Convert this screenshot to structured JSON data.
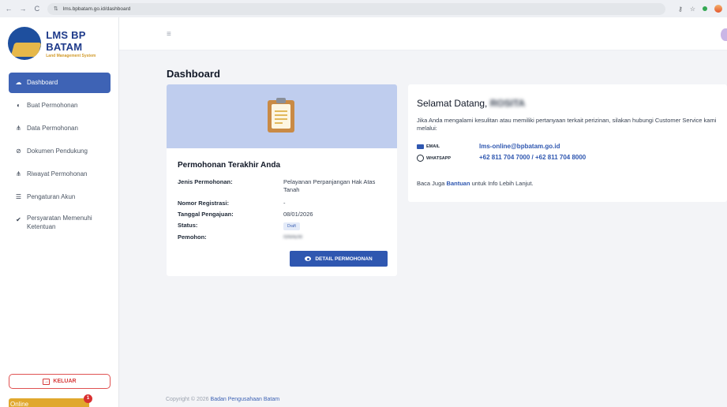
{
  "browser": {
    "url": "lms.bpbatam.go.id/dashboard",
    "back_icon": "←",
    "forward_icon": "→",
    "reload_icon": "C",
    "site_settings_icon": "⇅",
    "key_icon": "⚷",
    "star_icon": "☆"
  },
  "brand": {
    "title": "LMS BP BATAM",
    "subtitle": "Land Management System"
  },
  "sidebar": {
    "items": [
      {
        "label": "Dashboard",
        "icon": "cloud-icon",
        "glyph": "☁",
        "active": true
      },
      {
        "label": "Buat Permohonan",
        "icon": "globe-icon",
        "glyph": "◐",
        "active": false
      },
      {
        "label": "Data Permohonan",
        "icon": "sitemap-icon",
        "glyph": "⋔",
        "active": false
      },
      {
        "label": "Dokumen Pendukung",
        "icon": "paperclip-icon",
        "glyph": "⊘",
        "active": false
      },
      {
        "label": "Riwayat Permohonan",
        "icon": "sitemap-icon",
        "glyph": "⋔",
        "active": false
      },
      {
        "label": "Pengaturan Akun",
        "icon": "settings-icon",
        "glyph": "☰",
        "active": false
      },
      {
        "label": "Persyaratan Memenuhi Ketentuan",
        "icon": "check-circle-icon",
        "glyph": "✔",
        "active": false
      }
    ],
    "logout_label": "KELUAR",
    "logout_icon": "→",
    "online_label": "Online",
    "online_badge": "1"
  },
  "header": {
    "menu_icon": "≡"
  },
  "page": {
    "title": "Dashboard"
  },
  "application": {
    "heading": "Permohonan Terakhir Anda",
    "fields": {
      "jenis_label": "Jenis Permohonan:",
      "jenis_value": "Pelayanan Perpanjangan Hak Atas Tanah",
      "nomor_label": "Nomor Registrasi:",
      "nomor_value": "-",
      "tanggal_label": "Tanggal Pengajuan:",
      "tanggal_value": "08/01/2026",
      "status_label": "Status:",
      "status_value": "Draft",
      "pemohon_label": "Pemohon:",
      "pemohon_value": "ISNAENI"
    },
    "detail_button": "DETAIL PERMOHONAN"
  },
  "welcome": {
    "greeting": "Selamat Datang,",
    "name": "ROSITA",
    "description": "Jika Anda mengalami kesulitan atau memiliki pertanyaan terkait perizinan, silakan hubungi Customer Service kami melalui:",
    "email_label": "EMAIL",
    "email_value": "lms-online@bpbatam.go.id",
    "whatsapp_label": "WHATSAPP",
    "whatsapp_value": "+62 811 704 7000 / +62 811 704 8000",
    "read_prefix": "Baca Juga",
    "read_link": "Bantuan",
    "read_suffix": "untuk Info Lebih Lanjut."
  },
  "footer": {
    "copyright": "Copyright © 2026",
    "org_link": "Badan Pengusahaan Batam"
  },
  "colors": {
    "primary": "#3e63b5",
    "hero": "#bfcdee",
    "danger": "#d63b3b",
    "online": "#e0a82e"
  }
}
